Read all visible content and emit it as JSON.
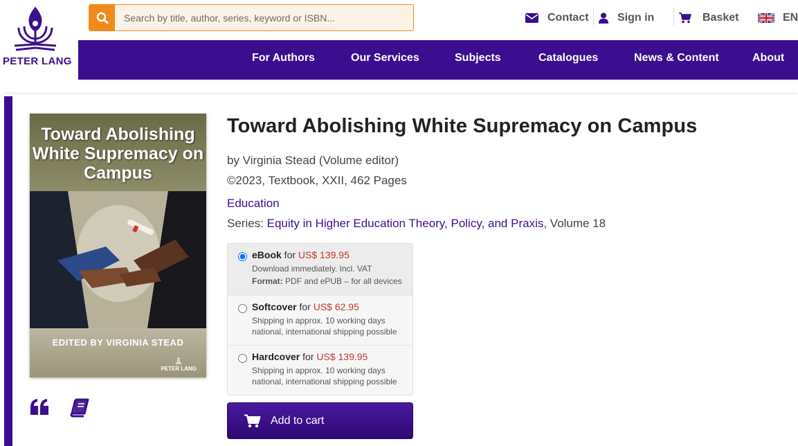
{
  "header": {
    "logo_text": "PETER LANG",
    "search": {
      "placeholder": "Search by title, author, series, keyword or ISBN..."
    },
    "links": {
      "contact": "Contact",
      "sign_in": "Sign in",
      "basket": "Basket",
      "language": "EN"
    }
  },
  "nav": {
    "items": [
      "For Authors",
      "Our Services",
      "Subjects",
      "Catalogues",
      "News & Content",
      "About"
    ]
  },
  "cover": {
    "title": "Toward Abolishing White Supremacy on Campus",
    "editor": "EDITED BY VIRGINIA STEAD",
    "publisher": "PETER LANG"
  },
  "book": {
    "title": "Toward Abolishing White Supremacy on Campus",
    "byline": "by Virginia Stead (Volume editor)",
    "details": "©2023, Textbook, XXII, 462 Pages",
    "subject": "Education",
    "series_label": "Series: ",
    "series_name": "Equity in Higher Education Theory, Policy, and Praxis",
    "series_volume": ", Volume 18"
  },
  "options": [
    {
      "format": "eBook",
      "for": " for ",
      "price": "US$ 139.95",
      "line2": "Download immediately. Incl. VAT",
      "line3_label": "Format:",
      "line3": " PDF and ePUB – for all devices",
      "selected": true
    },
    {
      "format": "Softcover",
      "for": " for ",
      "price": "US$ 62.95",
      "line2": "Shipping in approx. 10 working days",
      "line3": "national, international shipping possible",
      "selected": false
    },
    {
      "format": "Hardcover",
      "for": " for ",
      "price": "US$ 139.95",
      "line2": "Shipping in approx. 10 working days",
      "line3": "national, international shipping possible",
      "selected": false
    }
  ],
  "cart_button": "Add to cart",
  "colors": {
    "brand_purple": "#3b0e8f",
    "accent_orange": "#f08a1a",
    "price_red": "#c0392b"
  },
  "icons": [
    "search-icon",
    "envelope-icon",
    "user-icon",
    "cart-icon",
    "uk-flag-icon",
    "quote-icon",
    "book-icon"
  ]
}
